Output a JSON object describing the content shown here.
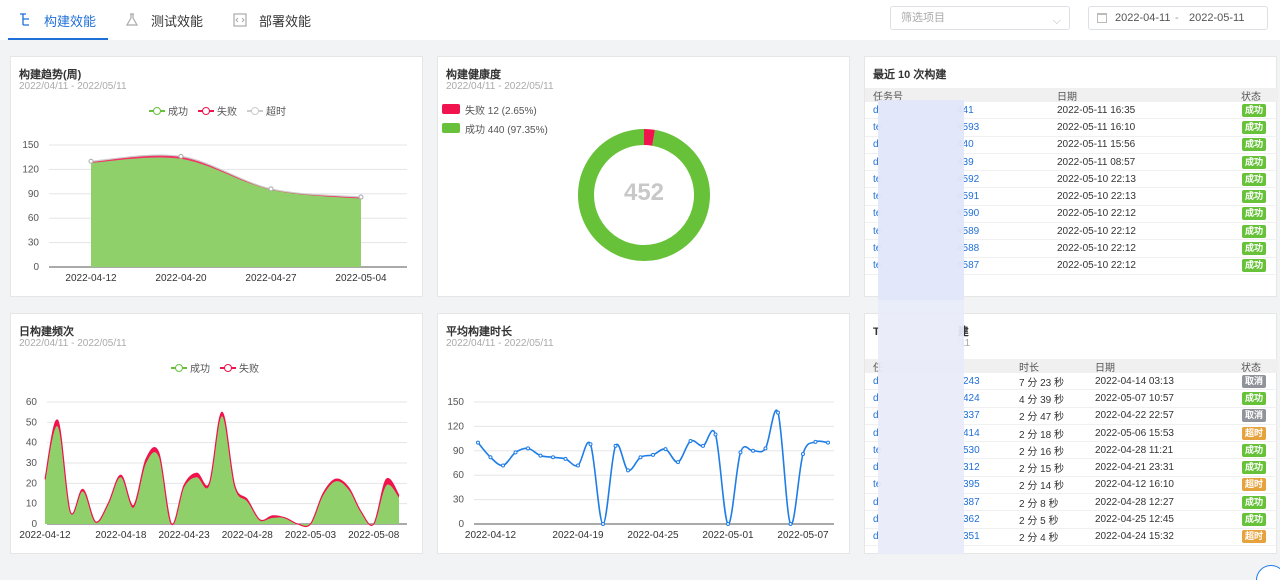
{
  "tabs": [
    {
      "label": "构建效能",
      "icon": "build-tree-icon",
      "active": true
    },
    {
      "label": "测试效能",
      "icon": "flask-icon",
      "active": false
    },
    {
      "label": "部署效能",
      "icon": "code-file-icon",
      "active": false
    }
  ],
  "filter": {
    "placeholder": "筛选项目"
  },
  "date_range": {
    "start": "2022-04-11",
    "separator": "-",
    "end": "2022-05-11"
  },
  "colors": {
    "success": "#67c23a",
    "fail": "#f0134d",
    "timeout": "#cccccc",
    "cancel": "#909399",
    "timeout_badge": "#e6a23c",
    "line": "#1f7de6",
    "accent": "#1f6fd8"
  },
  "cards": {
    "trend": {
      "title": "构建趋势(周)",
      "subtitle": "2022/04/11 - 2022/05/11",
      "legend": [
        "成功",
        "失败",
        "超时"
      ]
    },
    "health": {
      "title": "构建健康度",
      "subtitle": "2022/04/11 - 2022/05/11",
      "legend": [
        "失败 12 (2.65%)",
        "成功 440 (97.35%)"
      ],
      "total": "452"
    },
    "recent": {
      "title": "最近 10 次构建",
      "headers": [
        "任务号",
        "日期",
        "状态"
      ]
    },
    "daily": {
      "title": "日构建频次",
      "subtitle": "2022/04/11 - 2022/05/11",
      "legend": [
        "成功",
        "失败"
      ]
    },
    "avg": {
      "title": "平均构建时长",
      "subtitle": "2022/04/11 - 2022/05/11"
    },
    "longest": {
      "title_prefix": "T",
      "title_suffix": "建",
      "sub_suffix": "/11",
      "headers": [
        "任",
        "时长",
        "日期",
        "状态"
      ]
    }
  },
  "recent_rows": [
    {
      "id_pre": "d",
      "id_suf": "441",
      "date": "2022-05-11 16:35",
      "status": "成功"
    },
    {
      "id_pre": "te",
      "id_suf": "#593",
      "date": "2022-05-11 16:10",
      "status": "成功"
    },
    {
      "id_pre": "d",
      "id_suf": "440",
      "date": "2022-05-11 15:56",
      "status": "成功"
    },
    {
      "id_pre": "d",
      "id_suf": "439",
      "date": "2022-05-11 08:57",
      "status": "成功"
    },
    {
      "id_pre": "te",
      "id_suf": "#592",
      "date": "2022-05-10 22:13",
      "status": "成功"
    },
    {
      "id_pre": "te",
      "id_suf": "#591",
      "date": "2022-05-10 22:13",
      "status": "成功"
    },
    {
      "id_pre": "te",
      "id_suf": "#590",
      "date": "2022-05-10 22:12",
      "status": "成功"
    },
    {
      "id_pre": "te",
      "id_suf": "#589",
      "date": "2022-05-10 22:12",
      "status": "成功"
    },
    {
      "id_pre": "te",
      "id_suf": "#588",
      "date": "2022-05-10 22:12",
      "status": "成功"
    },
    {
      "id_pre": "te",
      "id_suf": "#587",
      "date": "2022-05-10 22:12",
      "status": "成功"
    }
  ],
  "longest_rows": [
    {
      "id_pre": "d",
      "id_suf": "243",
      "duration": "7 分 23 秒",
      "date": "2022-04-14 03:13",
      "status": "取消",
      "kind": "cancel"
    },
    {
      "id_pre": "d",
      "id_suf": "424",
      "duration": "4 分 39 秒",
      "date": "2022-05-07 10:57",
      "status": "成功",
      "kind": "success"
    },
    {
      "id_pre": "d",
      "id_suf": "337",
      "duration": "2 分 47 秒",
      "date": "2022-04-22 22:57",
      "status": "取消",
      "kind": "cancel"
    },
    {
      "id_pre": "d",
      "id_suf": "414",
      "duration": "2 分 18 秒",
      "date": "2022-05-06 15:53",
      "status": "超时",
      "kind": "timeout"
    },
    {
      "id_pre": "te",
      "id_suf": "530",
      "duration": "2 分 16 秒",
      "date": "2022-04-28 11:21",
      "status": "成功",
      "kind": "success"
    },
    {
      "id_pre": "d",
      "id_suf": "312",
      "duration": "2 分 15 秒",
      "date": "2022-04-21 23:31",
      "status": "成功",
      "kind": "success"
    },
    {
      "id_pre": "te",
      "id_suf": "395",
      "duration": "2 分 14 秒",
      "date": "2022-04-12 16:10",
      "status": "超时",
      "kind": "timeout"
    },
    {
      "id_pre": "d",
      "id_suf": "387",
      "duration": "2 分 8 秒",
      "date": "2022-04-28 12:27",
      "status": "成功",
      "kind": "success"
    },
    {
      "id_pre": "d",
      "id_suf": "362",
      "duration": "2 分 5 秒",
      "date": "2022-04-25 12:45",
      "status": "成功",
      "kind": "success"
    },
    {
      "id_pre": "d",
      "id_suf": "351",
      "duration": "2 分 4 秒",
      "date": "2022-04-24 15:32",
      "status": "超时",
      "kind": "timeout"
    }
  ],
  "chart_data": [
    {
      "type": "area",
      "title": "构建趋势(周)",
      "x": [
        "2022-04-12",
        "2022-04-20",
        "2022-04-27",
        "2022-05-04"
      ],
      "ylim": [
        0,
        150
      ],
      "yticks": [
        0,
        30,
        60,
        90,
        120,
        150
      ],
      "series": [
        {
          "name": "成功",
          "values": [
            128,
            133,
            95,
            84
          ]
        },
        {
          "name": "失败",
          "values": [
            2,
            3,
            1,
            2
          ]
        },
        {
          "name": "超时",
          "values": [
            0,
            0,
            0,
            0
          ]
        }
      ]
    },
    {
      "type": "pie",
      "title": "构建健康度",
      "series": [
        {
          "name": "失败",
          "value": 12
        },
        {
          "name": "成功",
          "value": 440
        }
      ]
    },
    {
      "type": "area",
      "title": "日构建频次",
      "x_ticks": [
        "2022-04-12",
        "2022-04-18",
        "2022-04-23",
        "2022-04-28",
        "2022-05-03",
        "2022-05-08"
      ],
      "ylim": [
        0,
        60
      ],
      "yticks": [
        0,
        10,
        20,
        30,
        40,
        50,
        60
      ],
      "x": [
        "04-11",
        "04-12",
        "04-13",
        "04-14",
        "04-15",
        "04-16",
        "04-17",
        "04-18",
        "04-19",
        "04-20",
        "04-21",
        "04-22",
        "04-23",
        "04-24",
        "04-25",
        "04-26",
        "04-27",
        "04-28",
        "04-29",
        "04-30",
        "05-01",
        "05-02",
        "05-03",
        "05-04",
        "05-05",
        "05-06",
        "05-07",
        "05-08",
        "05-09"
      ],
      "series": [
        {
          "name": "成功",
          "values": [
            21,
            48,
            6,
            16,
            1,
            10,
            23,
            8,
            30,
            33,
            0,
            18,
            23,
            19,
            53,
            18,
            11,
            2,
            3,
            3,
            0,
            0,
            14,
            21,
            17,
            6,
            0,
            19,
            13
          ]
        },
        {
          "name": "失败",
          "values": [
            1,
            3,
            0,
            1,
            0,
            0,
            1,
            1,
            2,
            2,
            0,
            1,
            2,
            1,
            2,
            1,
            1,
            0,
            1,
            0,
            0,
            0,
            1,
            1,
            1,
            0,
            0,
            3,
            1
          ]
        }
      ]
    },
    {
      "type": "line",
      "title": "平均构建时长",
      "x_ticks": [
        "2022-04-12",
        "2022-04-19",
        "2022-04-25",
        "2022-05-01",
        "2022-05-07"
      ],
      "ylim": [
        0,
        150
      ],
      "yticks": [
        0,
        30,
        60,
        90,
        120,
        150
      ],
      "x": [
        "04-11",
        "04-12",
        "04-13",
        "04-14",
        "04-15",
        "04-16",
        "04-17",
        "04-18",
        "04-19",
        "04-20",
        "04-21",
        "04-22",
        "04-23",
        "04-24",
        "04-25",
        "04-26",
        "04-27",
        "04-28",
        "04-29",
        "04-30",
        "05-01",
        "05-02",
        "05-03",
        "05-04",
        "05-05",
        "05-06",
        "05-07",
        "05-08",
        "05-09"
      ],
      "series": [
        {
          "name": "平均构建时长",
          "values": [
            100,
            82,
            72,
            88,
            93,
            84,
            82,
            80,
            72,
            98,
            0,
            96,
            66,
            82,
            85,
            92,
            76,
            102,
            96,
            110,
            0,
            88,
            90,
            93,
            137,
            0,
            86,
            101,
            100
          ]
        }
      ]
    }
  ]
}
